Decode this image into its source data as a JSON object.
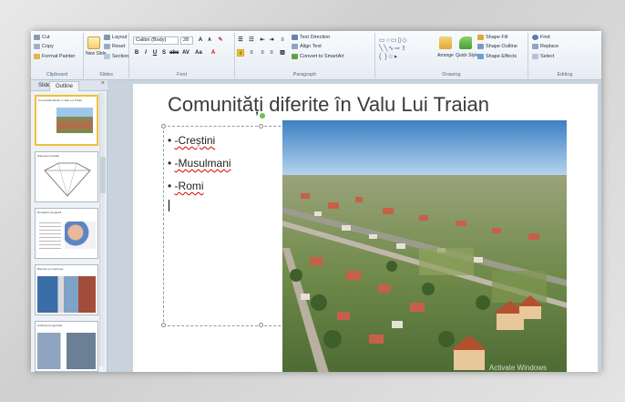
{
  "ribbon": {
    "clipboard": {
      "cut": "Cut",
      "copy": "Copy",
      "format_painter": "Format Painter",
      "label": "Clipboard"
    },
    "slides": {
      "new_slide": "New Slide",
      "layout": "Layout",
      "reset": "Reset",
      "section": "Section",
      "label": "Slides"
    },
    "font": {
      "name": "Calibri (Body)",
      "size": "28",
      "label": "Font"
    },
    "paragraph": {
      "text_direction": "Text Direction",
      "align_text": "Align Text",
      "convert_smartart": "Convert to SmartArt",
      "label": "Paragraph"
    },
    "drawing": {
      "arrange": "Arrange",
      "quick_styles": "Quick Styles",
      "shape_fill": "Shape Fill",
      "shape_outline": "Shape Outline",
      "shape_effects": "Shape Effects",
      "label": "Drawing"
    },
    "editing": {
      "find": "Find",
      "replace": "Replace",
      "select": "Select",
      "label": "Editing"
    }
  },
  "sidebar": {
    "tab_slides": "Slides",
    "tab_outline": "Outline",
    "close": "×",
    "thumbs": [
      {
        "title": "Comunități diferite în Valu Lui Traian"
      },
      {
        "title": "Diamantul socială"
      },
      {
        "title": "Română și Engleză"
      },
      {
        "title": "Biserica și moscheea"
      },
      {
        "title": "Arhitectura specifică"
      }
    ]
  },
  "slide": {
    "title": "Comunități diferite în Valu Lui Traian",
    "bullets": [
      "-Creștini",
      "-Musulmani",
      "-Romi"
    ],
    "bullet_char": "•",
    "watermark": "Activate Windows"
  },
  "colors": {
    "ribbon_bg": "#e6ecf3",
    "accent": "#f0c040",
    "title_text": "#3b3b3b"
  }
}
